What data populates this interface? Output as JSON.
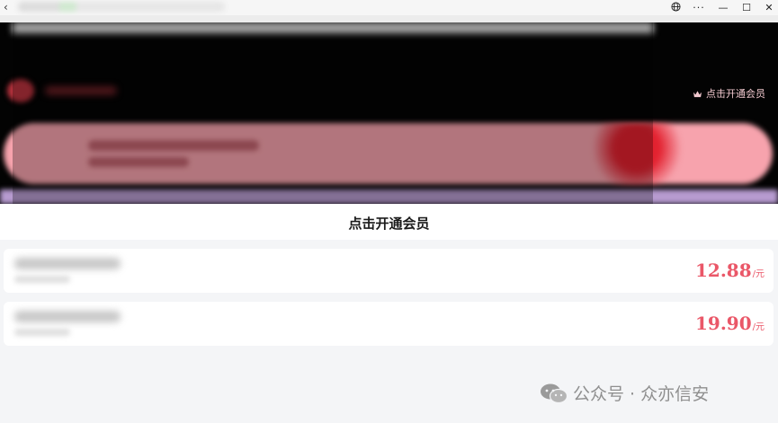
{
  "window": {
    "back_glyph": "‹",
    "icons": [
      "globe-icon",
      "more-icon",
      "minimize-icon",
      "maximize-icon",
      "close-icon"
    ],
    "more_glyph": "···",
    "minimize_glyph": "—",
    "maximize_glyph": "☐",
    "close_glyph": "✕"
  },
  "banner": {
    "vip_button_label": "点击开通会员",
    "vip_icon": "crown-icon"
  },
  "section": {
    "title": "点击开通会员"
  },
  "plans": [
    {
      "price": "12.88",
      "unit": "/元"
    },
    {
      "price": "19.90",
      "unit": "/元"
    }
  ],
  "watermark": {
    "icon": "wechat-icon",
    "text": "公众号 · 众亦信安"
  },
  "colors": {
    "price": "#ea5768",
    "banner_bg": "#030303",
    "page_bg": "#f4f5f7",
    "vip_text": "#f2c9cf"
  }
}
